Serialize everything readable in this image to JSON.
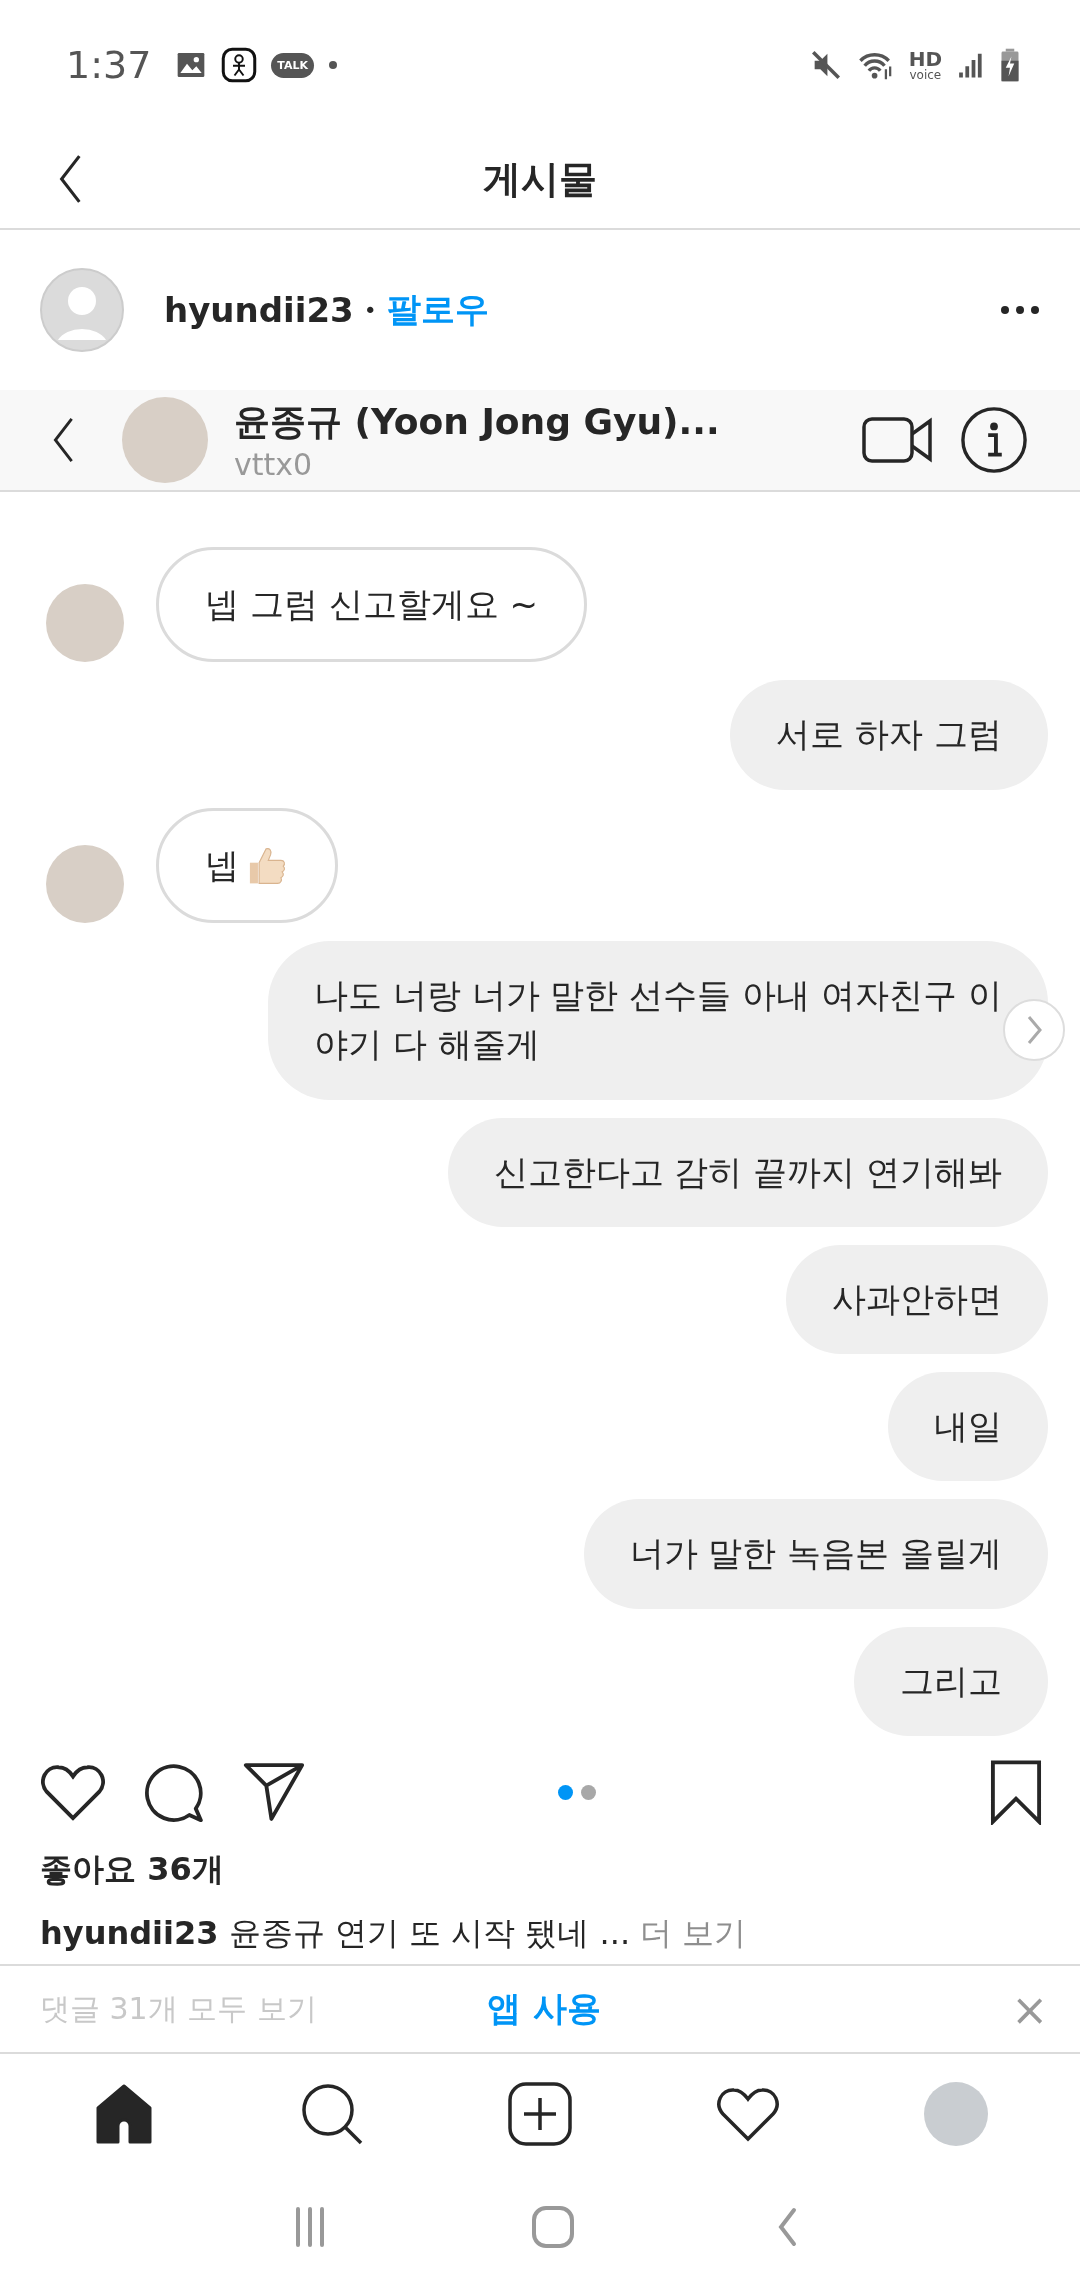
{
  "status_bar": {
    "time": "1:37",
    "talk_badge": "TALK",
    "hd_label": "HD",
    "voice_label": "voice"
  },
  "header": {
    "title": "게시물"
  },
  "post": {
    "username": "hyundii23",
    "separator": "•",
    "follow": "팔로우",
    "chat": {
      "name": "윤종규 (Yoon Jong Gyu)...",
      "handle": "vttx0",
      "messages": [
        {
          "outgoing": false,
          "kind": "text",
          "text": "넵 그럼 신고할게요 ~"
        },
        {
          "outgoing": true,
          "kind": "text",
          "text": "서로 하자 그럼"
        },
        {
          "outgoing": false,
          "kind": "thumb",
          "text": "넵"
        },
        {
          "outgoing": true,
          "kind": "text",
          "text": "나도 너랑 너가 말한 선수들 아내 여자친구 이야기 다 해줄게"
        },
        {
          "outgoing": true,
          "kind": "text",
          "text": "신고한다고 감히 끝까지 연기해봐"
        },
        {
          "outgoing": true,
          "kind": "text",
          "text": "사과안하면"
        },
        {
          "outgoing": true,
          "kind": "text",
          "text": "내일"
        },
        {
          "outgoing": true,
          "kind": "text",
          "text": "너가 말한 녹음본 올릴게"
        },
        {
          "outgoing": true,
          "kind": "text",
          "text": "그리고"
        }
      ]
    },
    "page_dots": [
      {
        "selected": true
      },
      {
        "selected": false
      }
    ],
    "likes": "좋아요 36개",
    "caption": {
      "username": "hyundii23",
      "text": "윤종규 연기 또 시작 됐네 ...",
      "more": "더 보기"
    },
    "comments": "댓글 31개 모두 보기"
  },
  "banner": {
    "label": "앱 사용",
    "close": "×"
  },
  "nav_tabs": [
    {
      "kind": "home",
      "selected": true
    },
    {
      "kind": "search",
      "selected": false
    },
    {
      "kind": "add",
      "selected": false
    },
    {
      "kind": "activity",
      "selected": false
    },
    {
      "kind": "profile",
      "selected": false
    }
  ]
}
